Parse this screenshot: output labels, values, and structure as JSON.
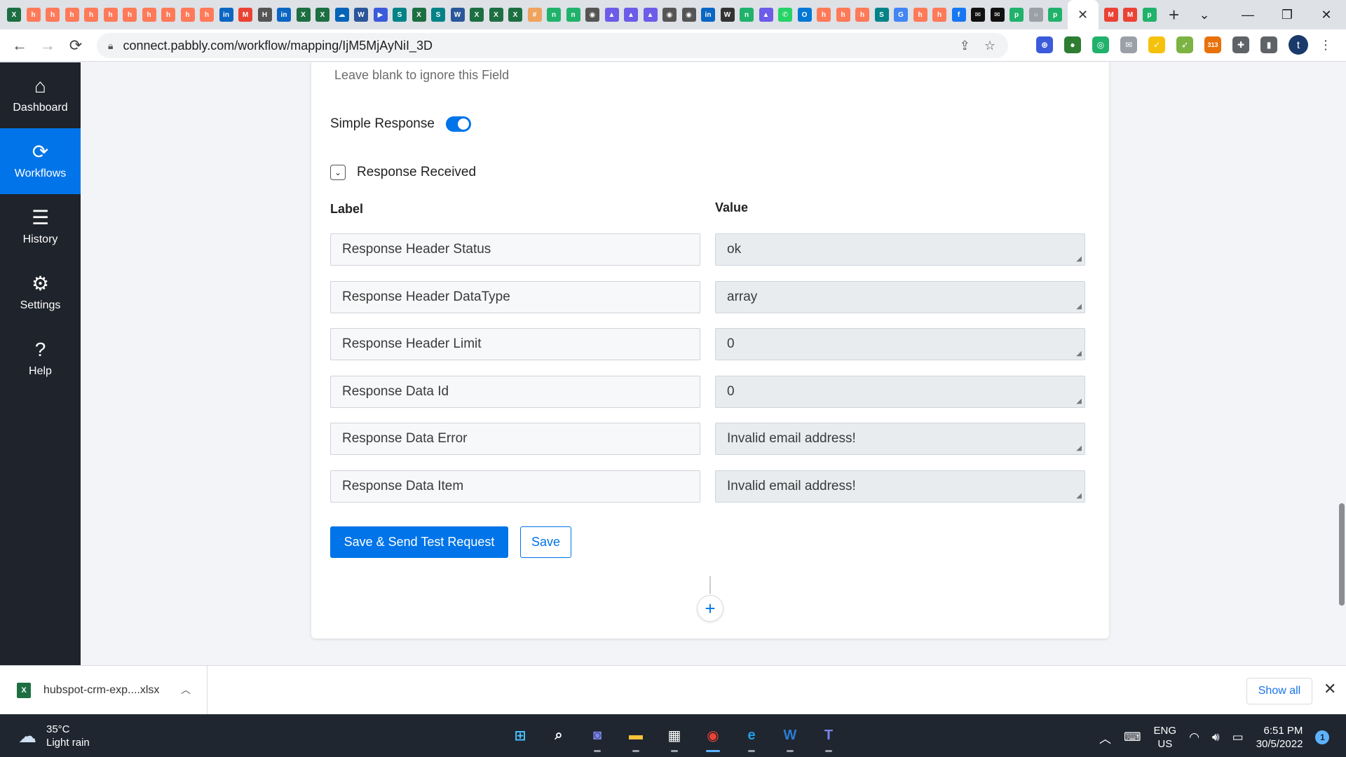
{
  "browser": {
    "url": "connect.pabbly.com/workflow/mapping/IjM5MjAyNiI_3D",
    "new_tab": "+",
    "tabs": [
      {
        "icon": "excel-icon",
        "color": "#1d6f42",
        "glyph": "X"
      },
      {
        "icon": "hubspot-icon",
        "color": "#ff7a59",
        "glyph": "h"
      },
      {
        "icon": "hubspot-icon",
        "color": "#ff7a59",
        "glyph": "h"
      },
      {
        "icon": "hubspot-icon",
        "color": "#ff7a59",
        "glyph": "h"
      },
      {
        "icon": "hubspot-icon",
        "color": "#ff7a59",
        "glyph": "h"
      },
      {
        "icon": "hubspot-icon",
        "color": "#ff7a59",
        "glyph": "h"
      },
      {
        "icon": "hubspot-icon",
        "color": "#ff7a59",
        "glyph": "h"
      },
      {
        "icon": "hubspot-icon",
        "color": "#ff7a59",
        "glyph": "h"
      },
      {
        "icon": "hubspot-icon",
        "color": "#ff7a59",
        "glyph": "h"
      },
      {
        "icon": "hubspot-icon",
        "color": "#ff7a59",
        "glyph": "h"
      },
      {
        "icon": "hubspot-icon",
        "color": "#ff7a59",
        "glyph": "h"
      },
      {
        "icon": "linkedin-icon",
        "color": "#0a66c2",
        "glyph": "in"
      },
      {
        "icon": "gmail-icon",
        "color": "#ea4335",
        "glyph": "M"
      },
      {
        "icon": "header-icon",
        "color": "#555555",
        "glyph": "H"
      },
      {
        "icon": "linkedin-icon",
        "color": "#0a66c2",
        "glyph": "in"
      },
      {
        "icon": "excel-icon",
        "color": "#1d6f42",
        "glyph": "X"
      },
      {
        "icon": "excel-icon",
        "color": "#1d6f42",
        "glyph": "X"
      },
      {
        "icon": "onedrive-icon",
        "color": "#0364b8",
        "glyph": "☁"
      },
      {
        "icon": "word-icon",
        "color": "#2b579a",
        "glyph": "W"
      },
      {
        "icon": "play-icon",
        "color": "#3b5bdb",
        "glyph": "▶"
      },
      {
        "icon": "sharepoint-icon",
        "color": "#038387",
        "glyph": "S"
      },
      {
        "icon": "excel-icon",
        "color": "#1d6f42",
        "glyph": "X"
      },
      {
        "icon": "sharepoint-icon",
        "color": "#038387",
        "glyph": "S"
      },
      {
        "icon": "word-icon",
        "color": "#2b579a",
        "glyph": "W"
      },
      {
        "icon": "excel-icon",
        "color": "#1d6f42",
        "glyph": "X"
      },
      {
        "icon": "excel-icon",
        "color": "#1d6f42",
        "glyph": "X"
      },
      {
        "icon": "excel-icon",
        "color": "#1d6f42",
        "glyph": "X"
      },
      {
        "icon": "grid-icon",
        "color": "#f0a35e",
        "glyph": "#"
      },
      {
        "icon": "pabbly-icon",
        "color": "#20b26b",
        "glyph": "n"
      },
      {
        "icon": "pabbly-icon",
        "color": "#20b26b",
        "glyph": "n"
      },
      {
        "icon": "globe-icon",
        "color": "#555555",
        "glyph": "◉"
      },
      {
        "icon": "drop-icon",
        "color": "#6c5ce7",
        "glyph": "▲"
      },
      {
        "icon": "drop-icon",
        "color": "#6c5ce7",
        "glyph": "▲"
      },
      {
        "icon": "drop-icon",
        "color": "#6c5ce7",
        "glyph": "▲"
      },
      {
        "icon": "globe-icon",
        "color": "#555555",
        "glyph": "◉"
      },
      {
        "icon": "globe-icon",
        "color": "#555555",
        "glyph": "◉"
      },
      {
        "icon": "linkedin-icon",
        "color": "#0a66c2",
        "glyph": "in"
      },
      {
        "icon": "wix-icon",
        "color": "#333333",
        "glyph": "W"
      },
      {
        "icon": "pabbly-icon",
        "color": "#20b26b",
        "glyph": "n"
      },
      {
        "icon": "drop-icon",
        "color": "#6c5ce7",
        "glyph": "▲"
      },
      {
        "icon": "whatsapp-icon",
        "color": "#25d366",
        "glyph": "✆"
      },
      {
        "icon": "outlook-icon",
        "color": "#0078d4",
        "glyph": "O"
      },
      {
        "icon": "hubspot-icon",
        "color": "#ff7a59",
        "glyph": "h"
      },
      {
        "icon": "hubspot-icon",
        "color": "#ff7a59",
        "glyph": "h"
      },
      {
        "icon": "hubspot-icon",
        "color": "#ff7a59",
        "glyph": "h"
      },
      {
        "icon": "sharepoint-icon",
        "color": "#038387",
        "glyph": "S"
      },
      {
        "icon": "google-icon",
        "color": "#4285f4",
        "glyph": "G"
      },
      {
        "icon": "hubspot-icon",
        "color": "#ff7a59",
        "glyph": "h"
      },
      {
        "icon": "hubspot-icon",
        "color": "#ff7a59",
        "glyph": "h"
      },
      {
        "icon": "facebook-icon",
        "color": "#1877f2",
        "glyph": "f"
      },
      {
        "icon": "envelope-icon",
        "color": "#111111",
        "glyph": "✉"
      },
      {
        "icon": "envelope-icon",
        "color": "#111111",
        "glyph": "✉"
      },
      {
        "icon": "pabbly-p-icon",
        "color": "#20b26b",
        "glyph": "p"
      },
      {
        "icon": "circle-icon",
        "color": "#9aa0a6",
        "glyph": "○"
      },
      {
        "icon": "pabbly-p-icon",
        "color": "#20b26b",
        "glyph": "p"
      },
      {
        "icon": "close-icon",
        "color": "#ffffff",
        "glyph": "✕",
        "active": true
      },
      {
        "icon": "gmail-icon",
        "color": "#ea4335",
        "glyph": "M"
      },
      {
        "icon": "gmail-icon",
        "color": "#ea4335",
        "glyph": "M"
      },
      {
        "icon": "pabbly-p-icon",
        "color": "#20b26b",
        "glyph": "p"
      }
    ],
    "extensions": [
      {
        "icon": "vpn-icon",
        "color": "#3b5bdb",
        "glyph": "⊕"
      },
      {
        "icon": "globe-icon",
        "color": "#2e7d32",
        "glyph": "●"
      },
      {
        "icon": "chat-icon",
        "color": "#20b26b",
        "glyph": "◎"
      },
      {
        "icon": "mail-icon",
        "color": "#9aa0a6",
        "glyph": "✉"
      },
      {
        "icon": "check-icon",
        "color": "#f4c20d",
        "glyph": "✓"
      },
      {
        "icon": "rocket-icon",
        "color": "#7cb342",
        "glyph": "➶"
      },
      {
        "icon": "counter-icon",
        "color": "#e8710a",
        "glyph": "313"
      },
      {
        "icon": "puzzle-icon",
        "color": "#5f6368",
        "glyph": "✚"
      },
      {
        "icon": "sidepanel-icon",
        "color": "#5f6368",
        "glyph": "▮"
      }
    ],
    "avatar": "t"
  },
  "sidebar": {
    "items": [
      {
        "label": "Dashboard",
        "icon": "home-icon",
        "glyph": "⌂"
      },
      {
        "label": "Workflows",
        "icon": "workflow-icon",
        "glyph": "⟳",
        "active": true
      },
      {
        "label": "History",
        "icon": "list-icon",
        "glyph": "☰"
      },
      {
        "label": "Settings",
        "icon": "gear-icon",
        "glyph": "⚙"
      },
      {
        "label": "Help",
        "icon": "help-icon",
        "glyph": "?"
      }
    ]
  },
  "form": {
    "hint": "Leave blank to ignore this Field",
    "simple_response_label": "Simple Response",
    "simple_response_on": true,
    "response_received_label": "Response Received",
    "label_header": "Label",
    "value_header": "Value",
    "rows": [
      {
        "label": "Response Header Status",
        "value": "ok"
      },
      {
        "label": "Response Header DataType",
        "value": "array"
      },
      {
        "label": "Response Header Limit",
        "value": "0"
      },
      {
        "label": "Response Data Id",
        "value": "0"
      },
      {
        "label": "Response Data Error",
        "value": "Invalid email address!"
      },
      {
        "label": "Response Data Item",
        "value": "Invalid email address!"
      }
    ],
    "save_send_label": "Save & Send Test Request",
    "save_label": "Save",
    "add_step": "+"
  },
  "downloads": {
    "file_name": "hubspot-crm-exp....xlsx",
    "file_icon_glyph": "X",
    "show_all": "Show all"
  },
  "taskbar": {
    "temperature": "35°C",
    "condition": "Light rain",
    "apps": [
      {
        "icon": "windows-start-icon",
        "color": "#4cc2ff",
        "glyph": "⊞"
      },
      {
        "icon": "search-icon",
        "color": "#ffffff",
        "glyph": "⌕"
      },
      {
        "icon": "chat-icon",
        "color": "#7b83eb",
        "glyph": "◙"
      },
      {
        "icon": "file-explorer-icon",
        "color": "#f8c33a",
        "glyph": "▬"
      },
      {
        "icon": "store-icon",
        "color": "#ffffff",
        "glyph": "▦"
      },
      {
        "icon": "chrome-icon",
        "color": "#ea4335",
        "glyph": "◉",
        "active": true
      },
      {
        "icon": "edge-icon",
        "color": "#1fa0e6",
        "glyph": "e"
      },
      {
        "icon": "word-icon",
        "color": "#2b7cd3",
        "glyph": "W"
      },
      {
        "icon": "teams-icon",
        "color": "#7b83eb",
        "glyph": "T"
      }
    ],
    "lang_top": "ENG",
    "lang_bottom": "US",
    "time": "6:51 PM",
    "date": "30/5/2022",
    "notifications": "1"
  },
  "colors": {
    "accent": "#0074e8",
    "sidebar_bg": "#1f232b"
  }
}
